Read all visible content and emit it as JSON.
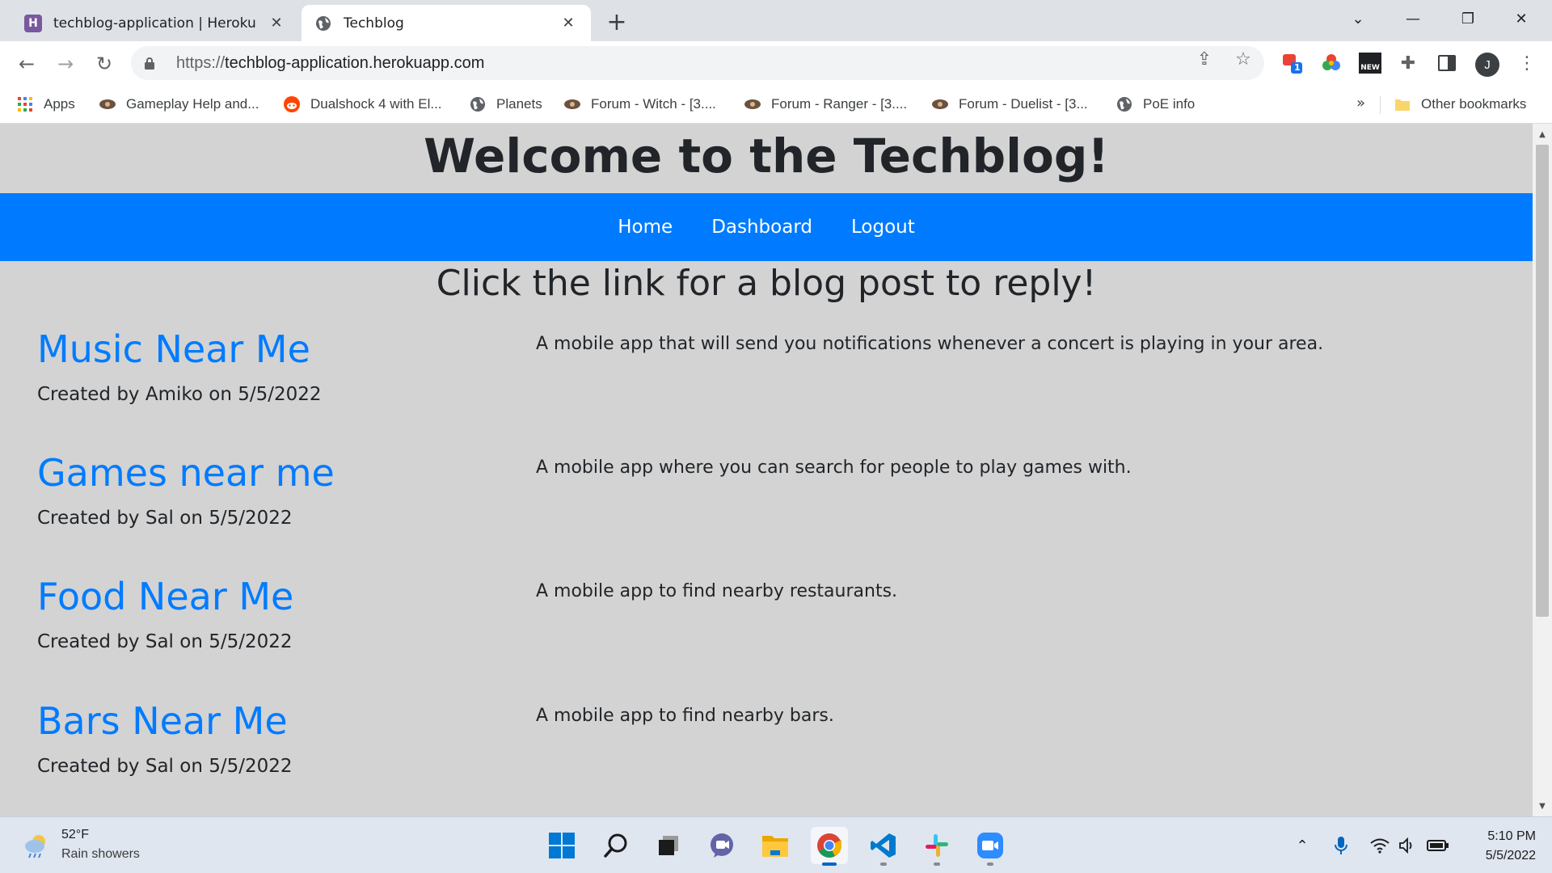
{
  "browser": {
    "tabs": [
      {
        "title": "techblog-application | Heroku",
        "favicon": "heroku-icon",
        "active": false
      },
      {
        "title": "Techblog",
        "favicon": "globe-icon",
        "active": true
      }
    ],
    "new_tab_label": "+",
    "url_scheme": "https://",
    "url_host": "techblog-application.herokuapp.com",
    "profile_initial": "J",
    "bookmarks": [
      {
        "label": "Apps",
        "icon": "apps-grid-icon"
      },
      {
        "label": "Gameplay Help and...",
        "icon": "poe-icon"
      },
      {
        "label": "Dualshock 4 with El...",
        "icon": "reddit-icon"
      },
      {
        "label": "Planets",
        "icon": "globe-icon"
      },
      {
        "label": "Forum - Witch - [3....",
        "icon": "poe-icon"
      },
      {
        "label": "Forum - Ranger - [3....",
        "icon": "poe-icon"
      },
      {
        "label": "Forum - Duelist - [3...",
        "icon": "poe-icon"
      },
      {
        "label": "PoE info",
        "icon": "globe-icon"
      }
    ],
    "bookmarks_overflow": "»",
    "other_bookmarks": "Other bookmarks",
    "extension_badge": "1",
    "extension_new_label": "NEW"
  },
  "site": {
    "title": "Welcome to the Techblog!",
    "nav": [
      "Home",
      "Dashboard",
      "Logout"
    ],
    "prompt": "Click the link for a blog post to reply!",
    "posts": [
      {
        "title": "Music Near Me",
        "meta": "Created by Amiko on 5/5/2022",
        "description": "A mobile app that will send you notifications whenever a concert is playing in your area."
      },
      {
        "title": "Games near me",
        "meta": "Created by Sal on 5/5/2022",
        "description": "A mobile app where you can search for people to play games with."
      },
      {
        "title": "Food Near Me",
        "meta": "Created by Sal on 5/5/2022",
        "description": "A mobile app to find nearby restaurants."
      },
      {
        "title": "Bars Near Me",
        "meta": "Created by Sal on 5/5/2022",
        "description": "A mobile app to find nearby bars."
      }
    ],
    "colors": {
      "nav_bg": "#007bff",
      "link": "#007bff",
      "page_bg": "#d3d3d3"
    }
  },
  "taskbar": {
    "weather_temp": "52°F",
    "weather_condition": "Rain showers",
    "apps": [
      "start-icon",
      "search-icon",
      "task-view-icon",
      "chat-icon",
      "file-explorer-icon",
      "chrome-icon",
      "vscode-icon",
      "slack-icon",
      "zoom-icon"
    ],
    "time": "5:10 PM",
    "date": "5/5/2022"
  }
}
